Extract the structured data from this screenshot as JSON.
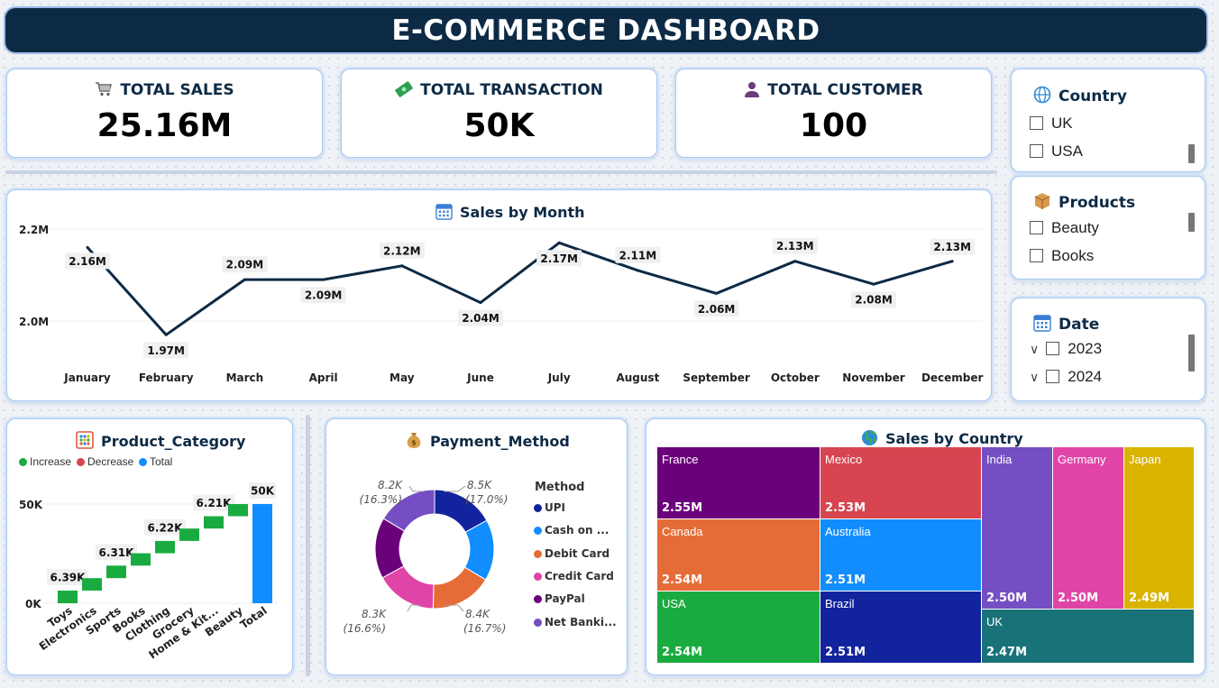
{
  "title": "E-COMMERCE DASHBOARD",
  "kpis": [
    {
      "label": "TOTAL SALES",
      "value": "25.16M",
      "icon": "cart-icon"
    },
    {
      "label": "TOTAL TRANSACTION",
      "value": "50K",
      "icon": "money-icon"
    },
    {
      "label": "TOTAL CUSTOMER",
      "value": "100",
      "icon": "person-icon"
    }
  ],
  "slicers": {
    "country": {
      "title": "Country",
      "icon": "globe-icon",
      "items": [
        "UK",
        "USA"
      ]
    },
    "products": {
      "title": "Products",
      "icon": "box-icon",
      "items": [
        "Beauty",
        "Books"
      ]
    },
    "date": {
      "title": "Date",
      "icon": "calendar-icon",
      "items": [
        "2023",
        "2024"
      ]
    }
  },
  "sales_by_month": {
    "title": "Sales by Month",
    "icon": "calendar-icon"
  },
  "product_category": {
    "title": "Product_Category",
    "icon": "abacus-icon",
    "legend": [
      {
        "label": "Increase",
        "color": "#1aab40"
      },
      {
        "label": "Decrease",
        "color": "#d64550"
      },
      {
        "label": "Total",
        "color": "#118dff"
      }
    ]
  },
  "payment_method": {
    "title": "Payment_Method",
    "icon": "money-bag-icon",
    "legend_title": "Method"
  },
  "sales_by_country": {
    "title": "Sales by Country",
    "icon": "globe-icon"
  },
  "chart_data": [
    {
      "id": "sales_by_month",
      "type": "line",
      "title": "Sales by Month",
      "categories": [
        "January",
        "February",
        "March",
        "April",
        "May",
        "June",
        "July",
        "August",
        "September",
        "October",
        "November",
        "December"
      ],
      "values": [
        2.16,
        1.97,
        2.09,
        2.09,
        2.12,
        2.04,
        2.17,
        2.11,
        2.06,
        2.13,
        2.08,
        2.13
      ],
      "data_labels": [
        "2.16M",
        "1.97M",
        "2.09M",
        "2.09M",
        "2.12M",
        "2.04M",
        "2.17M",
        "2.11M",
        "2.06M",
        "2.13M",
        "2.08M",
        "2.13M"
      ],
      "y_ticks": [
        "2.0M",
        "2.2M"
      ],
      "color": "#0d2a45",
      "grid": true
    },
    {
      "id": "product_category",
      "type": "bar",
      "subtype": "waterfall",
      "title": "Product_Category",
      "categories": [
        "Toys",
        "Electronics",
        "Sports",
        "Books",
        "Clothing",
        "Grocery",
        "Home & Kit...",
        "Beauty",
        "Total"
      ],
      "values": [
        6.39,
        6.26,
        6.31,
        6.23,
        6.22,
        6.25,
        6.21,
        6.13,
        50
      ],
      "data_labels": [
        "6.39K",
        "",
        "6.31K",
        "",
        "6.22K",
        "",
        "6.21K",
        "",
        "50K"
      ],
      "y_ticks": [
        "0K",
        "50K"
      ],
      "colors": {
        "increase": "#1aab40",
        "decrease": "#d64550",
        "total": "#118dff"
      },
      "legend_position": "top-left"
    },
    {
      "id": "payment_method",
      "type": "pie",
      "subtype": "donut",
      "title": "Payment_Method",
      "series": [
        {
          "name": "UPI",
          "value": 8.5,
          "color": "#12239e"
        },
        {
          "name": "Cash on ...",
          "value": 8.3,
          "color": "#118dff"
        },
        {
          "name": "Debit Card",
          "value": 8.4,
          "color": "#e66c37"
        },
        {
          "name": "Credit Card",
          "value": 8.3,
          "color": "#e044a7"
        },
        {
          "name": "PayPal",
          "value": 8.3,
          "color": "#6b007b"
        },
        {
          "name": "Net Banki...",
          "value": 8.2,
          "color": "#744ec2"
        }
      ],
      "data_labels": [
        {
          "value": "8.5K",
          "pct": "(17.0%)"
        },
        {
          "value": "8.4K",
          "pct": "(16.7%)"
        },
        {
          "value": "8.3K",
          "pct": "(16.6%)"
        },
        {
          "value": "8.2K",
          "pct": "(16.3%)"
        }
      ],
      "legend_position": "right"
    },
    {
      "id": "sales_by_country",
      "type": "treemap",
      "title": "Sales by Country",
      "items": [
        {
          "name": "France",
          "value": "2.55M",
          "color": "#6b007b"
        },
        {
          "name": "Mexico",
          "value": "2.53M",
          "color": "#d64550"
        },
        {
          "name": "Canada",
          "value": "2.54M",
          "color": "#e66c37"
        },
        {
          "name": "Australia",
          "value": "2.51M",
          "color": "#118dff"
        },
        {
          "name": "USA",
          "value": "2.54M",
          "color": "#1aab40"
        },
        {
          "name": "Brazil",
          "value": "2.51M",
          "color": "#12239e"
        },
        {
          "name": "India",
          "value": "2.50M",
          "color": "#744ec2"
        },
        {
          "name": "Germany",
          "value": "2.50M",
          "color": "#e044a7"
        },
        {
          "name": "Japan",
          "value": "2.49M",
          "color": "#d9b300"
        },
        {
          "name": "UK",
          "value": "2.47M",
          "color": "#197278"
        }
      ]
    }
  ]
}
